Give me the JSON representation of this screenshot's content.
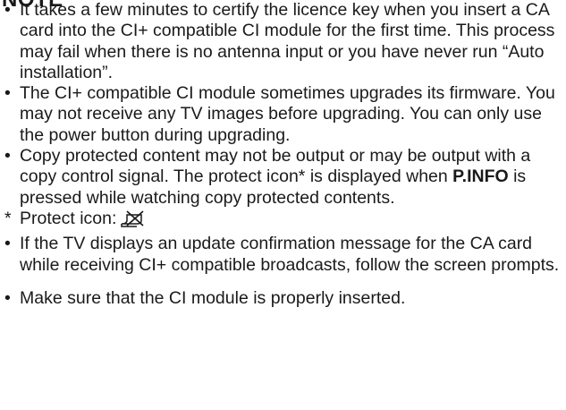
{
  "heading": "NOTE",
  "notes": [
    {
      "marker": "•",
      "text": "It takes a few minutes to certify the licence key when you insert a CA card into the CI+ compatible CI module for the first time. This process may fail when there is no antenna input or you have never run “Auto installation”."
    },
    {
      "marker": "•",
      "text": "The CI+ compatible CI module sometimes upgrades its firmware. You may not receive any TV images before upgrading. You can only use the power button during upgrading."
    },
    {
      "marker": "•",
      "text_before": "Copy protected content may not be output or may be output with a copy control signal. The protect icon* is displayed when ",
      "button": "P.INFO",
      "text_after": " is pressed while watching copy protected contents."
    },
    {
      "marker": "*",
      "label": "Protect icon:",
      "icon": "protect-icon"
    },
    {
      "marker": "•",
      "text": "If the TV displays an update confirmation message for the CA card while receiving CI+ compatible broadcasts, follow the screen prompts."
    },
    {
      "marker": "•",
      "text": "Make sure that the CI module is properly inserted."
    }
  ]
}
